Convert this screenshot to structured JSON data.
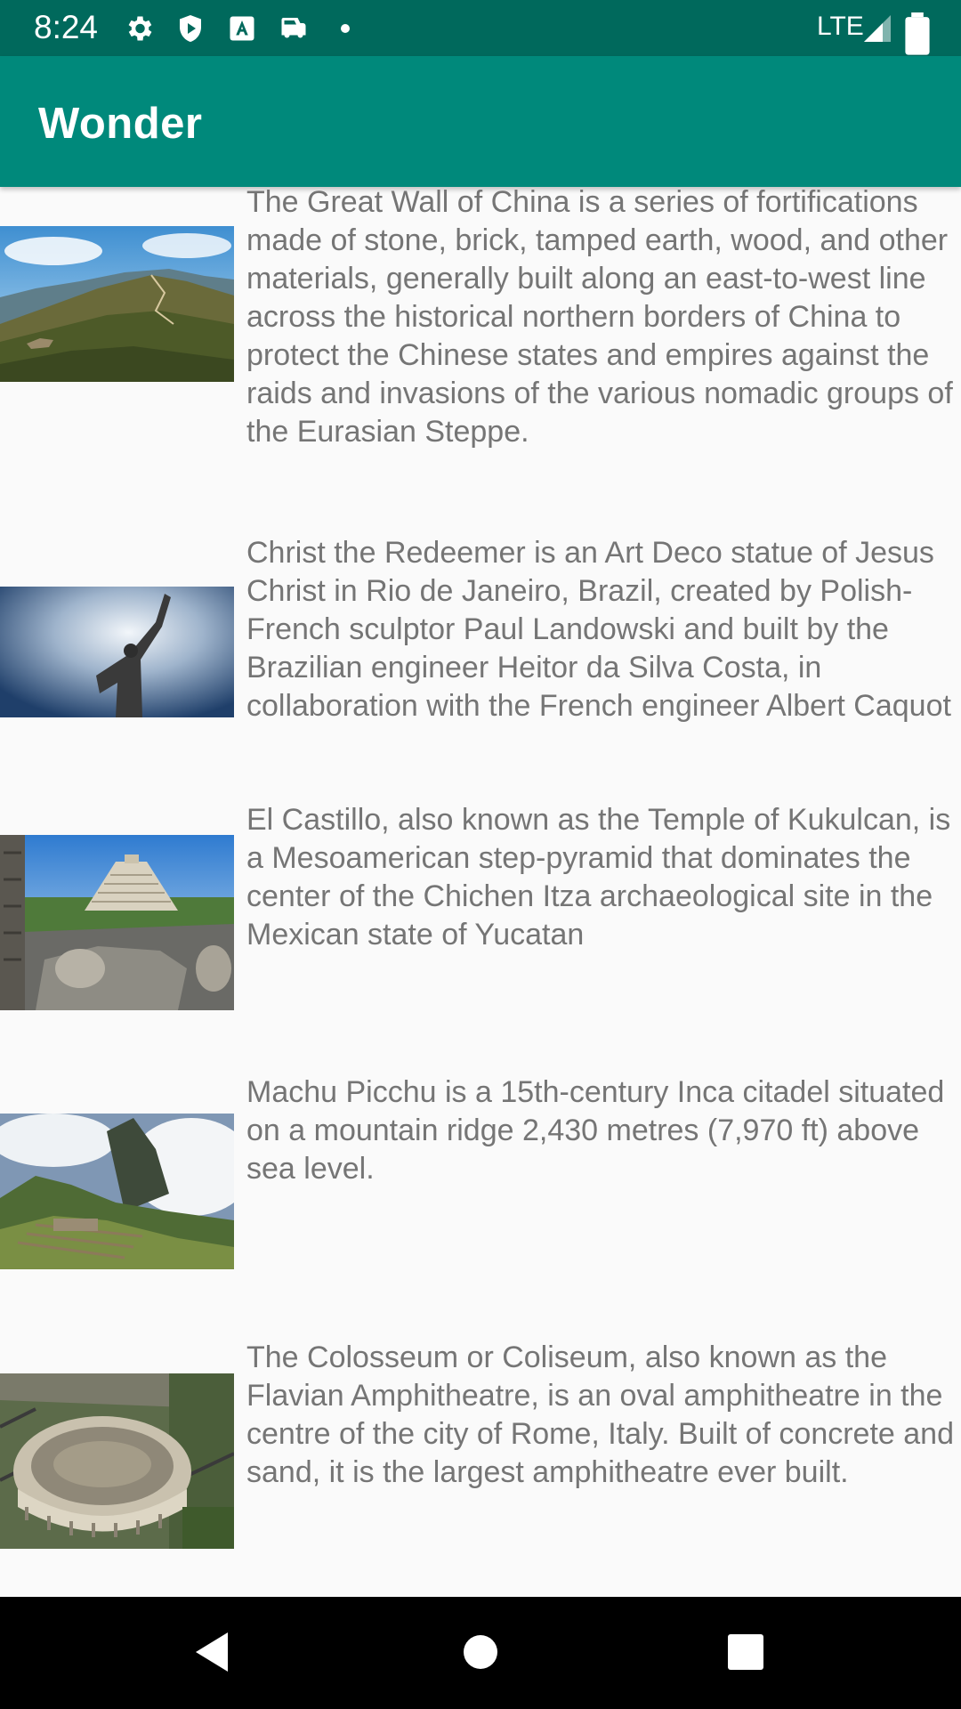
{
  "status_bar": {
    "time": "8:24",
    "network": "LTE",
    "icons": [
      "settings-icon",
      "shield-play-icon",
      "keyboard-a-icon",
      "car-mode-icon",
      "notification-dot-icon",
      "signal-icon",
      "battery-icon"
    ]
  },
  "app_bar": {
    "title": "Wonder"
  },
  "wonders": [
    {
      "image": "great-wall-image",
      "description": "The Great Wall of China is a series of fortifications made of stone, brick, tamped earth, wood, and other materials, generally built along an east-to-west line across the historical northern borders of China to protect the Chinese states and empires against the raids and invasions of the various nomadic groups of the Eurasian Steppe."
    },
    {
      "image": "christ-redeemer-image",
      "description": "Christ the Redeemer is an Art Deco statue of Jesus Christ in Rio de Janeiro, Brazil, created by Polish-French sculptor Paul Landowski and built by the Brazilian engineer Heitor da Silva Costa, in collaboration with the French engineer Albert Caquot"
    },
    {
      "image": "chichen-itza-image",
      "description": "El Castillo, also known as the Temple of Kukulcan, is a Mesoamerican step-pyramid that dominates the center of the Chichen Itza archaeological site in the Mexican state of Yucatan"
    },
    {
      "image": "machu-picchu-image",
      "description": "Machu Picchu is a 15th-century Inca citadel situated on a mountain ridge 2,430 metres (7,970 ft) above sea level."
    },
    {
      "image": "colosseum-image",
      "description": "The Colosseum or Coliseum, also known as the Flavian Amphitheatre, is an oval amphitheatre in the centre of the city of Rome, Italy. Built of concrete and sand, it is the largest amphitheatre ever built."
    }
  ],
  "nav_bar": {
    "buttons": [
      "back-icon",
      "home-icon",
      "recents-icon"
    ]
  },
  "colors": {
    "status_bar": "#00695c",
    "app_bar": "#00897b",
    "background": "#fafafa",
    "text": "#757575"
  }
}
